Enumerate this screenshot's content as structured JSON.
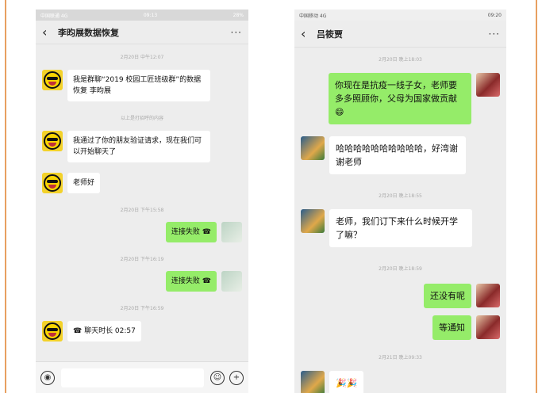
{
  "left": {
    "status": {
      "left": "中国联通 4G",
      "time": "09:13",
      "right": "28%"
    },
    "title": "李昀展数据恢复",
    "messages": [
      {
        "kind": "stamp",
        "text": "2月20日 中午12:07"
      },
      {
        "kind": "in",
        "avatar": "smiley",
        "text": "我是群聊“2019 校园工匠班级群”的数据恢复 李昀展"
      },
      {
        "kind": "stamp",
        "text": "以上是打招呼的内容"
      },
      {
        "kind": "in",
        "avatar": "smiley",
        "text": "我通过了你的朋友验证请求，现在我们可以开始聊天了"
      },
      {
        "kind": "in",
        "avatar": "smiley",
        "text": "老师好"
      },
      {
        "kind": "stamp",
        "text": "2月20日 下午15:58"
      },
      {
        "kind": "out",
        "avatar": "photo",
        "text": "连接失败 ☎"
      },
      {
        "kind": "stamp",
        "text": "2月20日 下午16:19"
      },
      {
        "kind": "out",
        "avatar": "photo",
        "text": "连接失败 ☎"
      },
      {
        "kind": "stamp",
        "text": "2月20日 下午16:59"
      },
      {
        "kind": "in",
        "avatar": "smiley",
        "text": "☎ 聊天时长 02:57"
      }
    ]
  },
  "right": {
    "status": {
      "left": "中国移动 4G",
      "time": "09:20",
      "right": ""
    },
    "title": "吕筱贾",
    "messages": [
      {
        "kind": "stamp",
        "text": "2月20日 晚上18:03"
      },
      {
        "kind": "out",
        "avatar": "girl",
        "text": "你现在是抗疫一线子女，老师要多多照顾你，父母为国家做贡献😄"
      },
      {
        "kind": "in",
        "avatar": "kid",
        "text": "哈哈哈哈哈哈哈哈哈哈，好湾谢谢老师"
      },
      {
        "kind": "stamp",
        "text": "2月20日 晚上18:55"
      },
      {
        "kind": "in",
        "avatar": "kid",
        "text": "老师，我们订下来什么时候开学了嘛？"
      },
      {
        "kind": "stamp",
        "text": "2月20日 晚上18:59"
      },
      {
        "kind": "out",
        "avatar": "girl",
        "text": "还没有呢"
      },
      {
        "kind": "out",
        "avatar": "girl",
        "text": "等通知"
      },
      {
        "kind": "stamp",
        "text": "2月21日 晚上09:33"
      },
      {
        "kind": "in",
        "avatar": "kid",
        "text": "🎉🎉"
      }
    ]
  },
  "icons": {
    "back": "‹",
    "more": "···",
    "voice": "◉",
    "emoji": "☺",
    "plus": "+"
  }
}
